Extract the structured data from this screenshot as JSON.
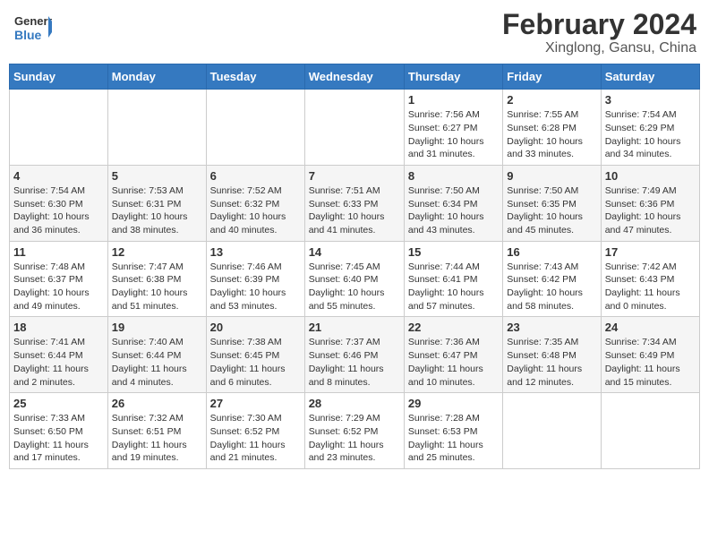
{
  "header": {
    "logo_line1": "General",
    "logo_line2": "Blue",
    "title": "February 2024",
    "subtitle": "Xinglong, Gansu, China"
  },
  "weekdays": [
    "Sunday",
    "Monday",
    "Tuesday",
    "Wednesday",
    "Thursday",
    "Friday",
    "Saturday"
  ],
  "weeks": [
    [
      {
        "day": "",
        "info": ""
      },
      {
        "day": "",
        "info": ""
      },
      {
        "day": "",
        "info": ""
      },
      {
        "day": "",
        "info": ""
      },
      {
        "day": "1",
        "info": "Sunrise: 7:56 AM\nSunset: 6:27 PM\nDaylight: 10 hours\nand 31 minutes."
      },
      {
        "day": "2",
        "info": "Sunrise: 7:55 AM\nSunset: 6:28 PM\nDaylight: 10 hours\nand 33 minutes."
      },
      {
        "day": "3",
        "info": "Sunrise: 7:54 AM\nSunset: 6:29 PM\nDaylight: 10 hours\nand 34 minutes."
      }
    ],
    [
      {
        "day": "4",
        "info": "Sunrise: 7:54 AM\nSunset: 6:30 PM\nDaylight: 10 hours\nand 36 minutes."
      },
      {
        "day": "5",
        "info": "Sunrise: 7:53 AM\nSunset: 6:31 PM\nDaylight: 10 hours\nand 38 minutes."
      },
      {
        "day": "6",
        "info": "Sunrise: 7:52 AM\nSunset: 6:32 PM\nDaylight: 10 hours\nand 40 minutes."
      },
      {
        "day": "7",
        "info": "Sunrise: 7:51 AM\nSunset: 6:33 PM\nDaylight: 10 hours\nand 41 minutes."
      },
      {
        "day": "8",
        "info": "Sunrise: 7:50 AM\nSunset: 6:34 PM\nDaylight: 10 hours\nand 43 minutes."
      },
      {
        "day": "9",
        "info": "Sunrise: 7:50 AM\nSunset: 6:35 PM\nDaylight: 10 hours\nand 45 minutes."
      },
      {
        "day": "10",
        "info": "Sunrise: 7:49 AM\nSunset: 6:36 PM\nDaylight: 10 hours\nand 47 minutes."
      }
    ],
    [
      {
        "day": "11",
        "info": "Sunrise: 7:48 AM\nSunset: 6:37 PM\nDaylight: 10 hours\nand 49 minutes."
      },
      {
        "day": "12",
        "info": "Sunrise: 7:47 AM\nSunset: 6:38 PM\nDaylight: 10 hours\nand 51 minutes."
      },
      {
        "day": "13",
        "info": "Sunrise: 7:46 AM\nSunset: 6:39 PM\nDaylight: 10 hours\nand 53 minutes."
      },
      {
        "day": "14",
        "info": "Sunrise: 7:45 AM\nSunset: 6:40 PM\nDaylight: 10 hours\nand 55 minutes."
      },
      {
        "day": "15",
        "info": "Sunrise: 7:44 AM\nSunset: 6:41 PM\nDaylight: 10 hours\nand 57 minutes."
      },
      {
        "day": "16",
        "info": "Sunrise: 7:43 AM\nSunset: 6:42 PM\nDaylight: 10 hours\nand 58 minutes."
      },
      {
        "day": "17",
        "info": "Sunrise: 7:42 AM\nSunset: 6:43 PM\nDaylight: 11 hours\nand 0 minutes."
      }
    ],
    [
      {
        "day": "18",
        "info": "Sunrise: 7:41 AM\nSunset: 6:44 PM\nDaylight: 11 hours\nand 2 minutes."
      },
      {
        "day": "19",
        "info": "Sunrise: 7:40 AM\nSunset: 6:44 PM\nDaylight: 11 hours\nand 4 minutes."
      },
      {
        "day": "20",
        "info": "Sunrise: 7:38 AM\nSunset: 6:45 PM\nDaylight: 11 hours\nand 6 minutes."
      },
      {
        "day": "21",
        "info": "Sunrise: 7:37 AM\nSunset: 6:46 PM\nDaylight: 11 hours\nand 8 minutes."
      },
      {
        "day": "22",
        "info": "Sunrise: 7:36 AM\nSunset: 6:47 PM\nDaylight: 11 hours\nand 10 minutes."
      },
      {
        "day": "23",
        "info": "Sunrise: 7:35 AM\nSunset: 6:48 PM\nDaylight: 11 hours\nand 12 minutes."
      },
      {
        "day": "24",
        "info": "Sunrise: 7:34 AM\nSunset: 6:49 PM\nDaylight: 11 hours\nand 15 minutes."
      }
    ],
    [
      {
        "day": "25",
        "info": "Sunrise: 7:33 AM\nSunset: 6:50 PM\nDaylight: 11 hours\nand 17 minutes."
      },
      {
        "day": "26",
        "info": "Sunrise: 7:32 AM\nSunset: 6:51 PM\nDaylight: 11 hours\nand 19 minutes."
      },
      {
        "day": "27",
        "info": "Sunrise: 7:30 AM\nSunset: 6:52 PM\nDaylight: 11 hours\nand 21 minutes."
      },
      {
        "day": "28",
        "info": "Sunrise: 7:29 AM\nSunset: 6:52 PM\nDaylight: 11 hours\nand 23 minutes."
      },
      {
        "day": "29",
        "info": "Sunrise: 7:28 AM\nSunset: 6:53 PM\nDaylight: 11 hours\nand 25 minutes."
      },
      {
        "day": "",
        "info": ""
      },
      {
        "day": "",
        "info": ""
      }
    ]
  ]
}
